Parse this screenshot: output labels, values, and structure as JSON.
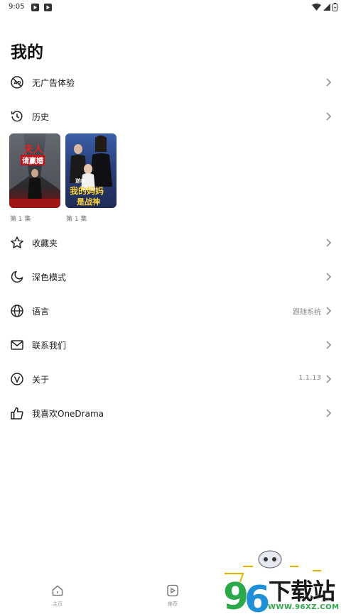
{
  "status_bar": {
    "time": "9:05"
  },
  "page_title": "我的",
  "menu": {
    "no_ads": {
      "label": "无广告体验",
      "icon": "no-ads-icon"
    },
    "history": {
      "label": "历史",
      "icon": "history-icon"
    },
    "favorites": {
      "label": "收藏夹",
      "icon": "star-icon"
    },
    "dark_mode": {
      "label": "深色模式",
      "icon": "moon-icon"
    },
    "language": {
      "label": "语言",
      "value": "跟随系统",
      "icon": "globe-icon"
    },
    "contact": {
      "label": "联系我们",
      "icon": "mail-icon"
    },
    "about": {
      "label": "关于",
      "value": "1.1.13",
      "icon": "version-icon"
    },
    "like": {
      "label": "我喜欢OneDrama",
      "icon": "thumbs-up-icon"
    }
  },
  "history_items": [
    {
      "poster_title_1": "夫人",
      "poster_title_2": "请赢婚",
      "episode": "第 1 集"
    },
    {
      "poster_title_1": "我的妈妈",
      "poster_title_2": "是战神",
      "poster_tag": "逆袭",
      "episode": "第 1 集"
    }
  ],
  "bottom_nav": [
    {
      "label": "主页",
      "icon": "home-icon"
    },
    {
      "label": "推荐",
      "icon": "play-icon"
    }
  ],
  "watermark": {
    "text": "96下载站",
    "domain": "WWW.96XZ.COM"
  },
  "colors": {
    "text": "#1a1a1a",
    "secondary": "#8a8a8a",
    "watermark_green": "#2aa84a"
  }
}
